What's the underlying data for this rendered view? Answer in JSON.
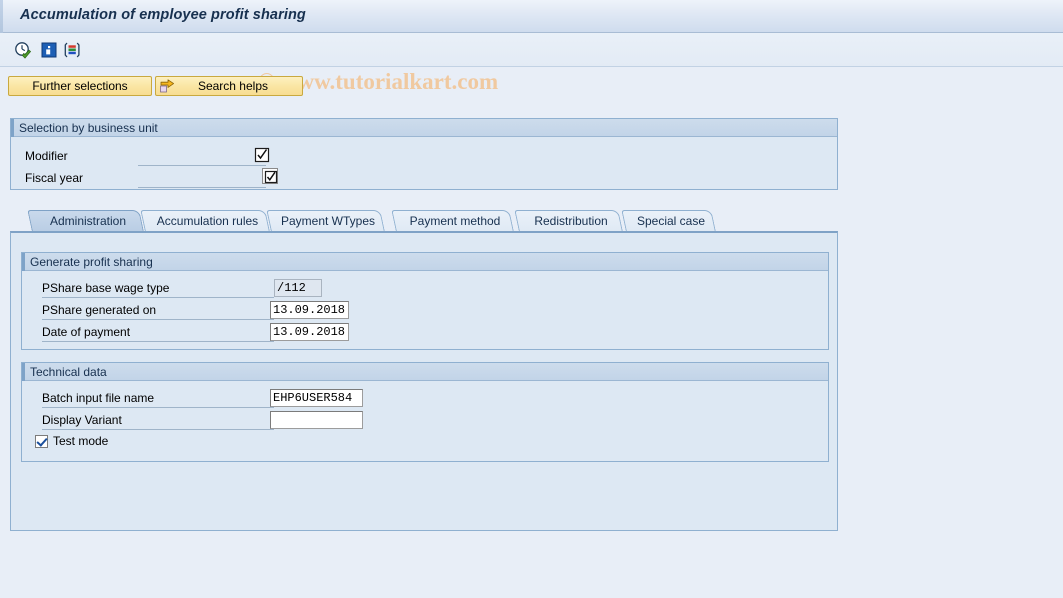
{
  "window": {
    "title": "Accumulation of employee profit sharing"
  },
  "watermark": {
    "text": "© www.tutorialkart.com"
  },
  "toolbar": {
    "icons": [
      {
        "name": "execute-clock-icon",
        "title": "Execute"
      },
      {
        "name": "information-icon",
        "title": "Information"
      },
      {
        "name": "layout-columns-icon",
        "title": "Layout"
      }
    ]
  },
  "buttons": {
    "further_selections": "Further selections",
    "search_helps": "Search helps",
    "search_helps_icon": "yellow-arrow-icon"
  },
  "selection_group": {
    "header": "Selection by business unit",
    "fields": [
      {
        "label": "Modifier",
        "value": "",
        "multi_select_icon": "multi-selection-icon"
      },
      {
        "label": "Fiscal year",
        "value": "",
        "multi_select_icon": "multi-selection-icon"
      }
    ]
  },
  "tabs": [
    {
      "label": "Administration",
      "selected": true
    },
    {
      "label": "Accumulation rules",
      "selected": false
    },
    {
      "label": "Payment WTypes",
      "selected": false
    },
    {
      "label": "Payment method",
      "selected": false
    },
    {
      "label": "Redistribution",
      "selected": false
    },
    {
      "label": "Special case",
      "selected": false
    }
  ],
  "generate_profit_sharing": {
    "header": "Generate profit sharing",
    "fields": [
      {
        "label": "PShare base wage type",
        "value": "/112"
      },
      {
        "label": "PShare generated on",
        "value": "13.09.2018"
      },
      {
        "label": "Date of payment",
        "value": "13.09.2018"
      }
    ]
  },
  "technical_data": {
    "header": "Technical data",
    "fields": [
      {
        "label": "Batch input file name",
        "value": "EHP6USER584"
      },
      {
        "label": "Display Variant",
        "value": ""
      }
    ],
    "checkbox": {
      "label": "Test mode",
      "checked": true
    }
  },
  "colors": {
    "background": "#e8eef7",
    "panel": "#dde8f3",
    "border": "#8fb0d0",
    "title_text": "#17304f",
    "button_yellow": "#fae6a4",
    "watermark": "#f0c9a0",
    "selected_tab": "#c9d9ec"
  }
}
